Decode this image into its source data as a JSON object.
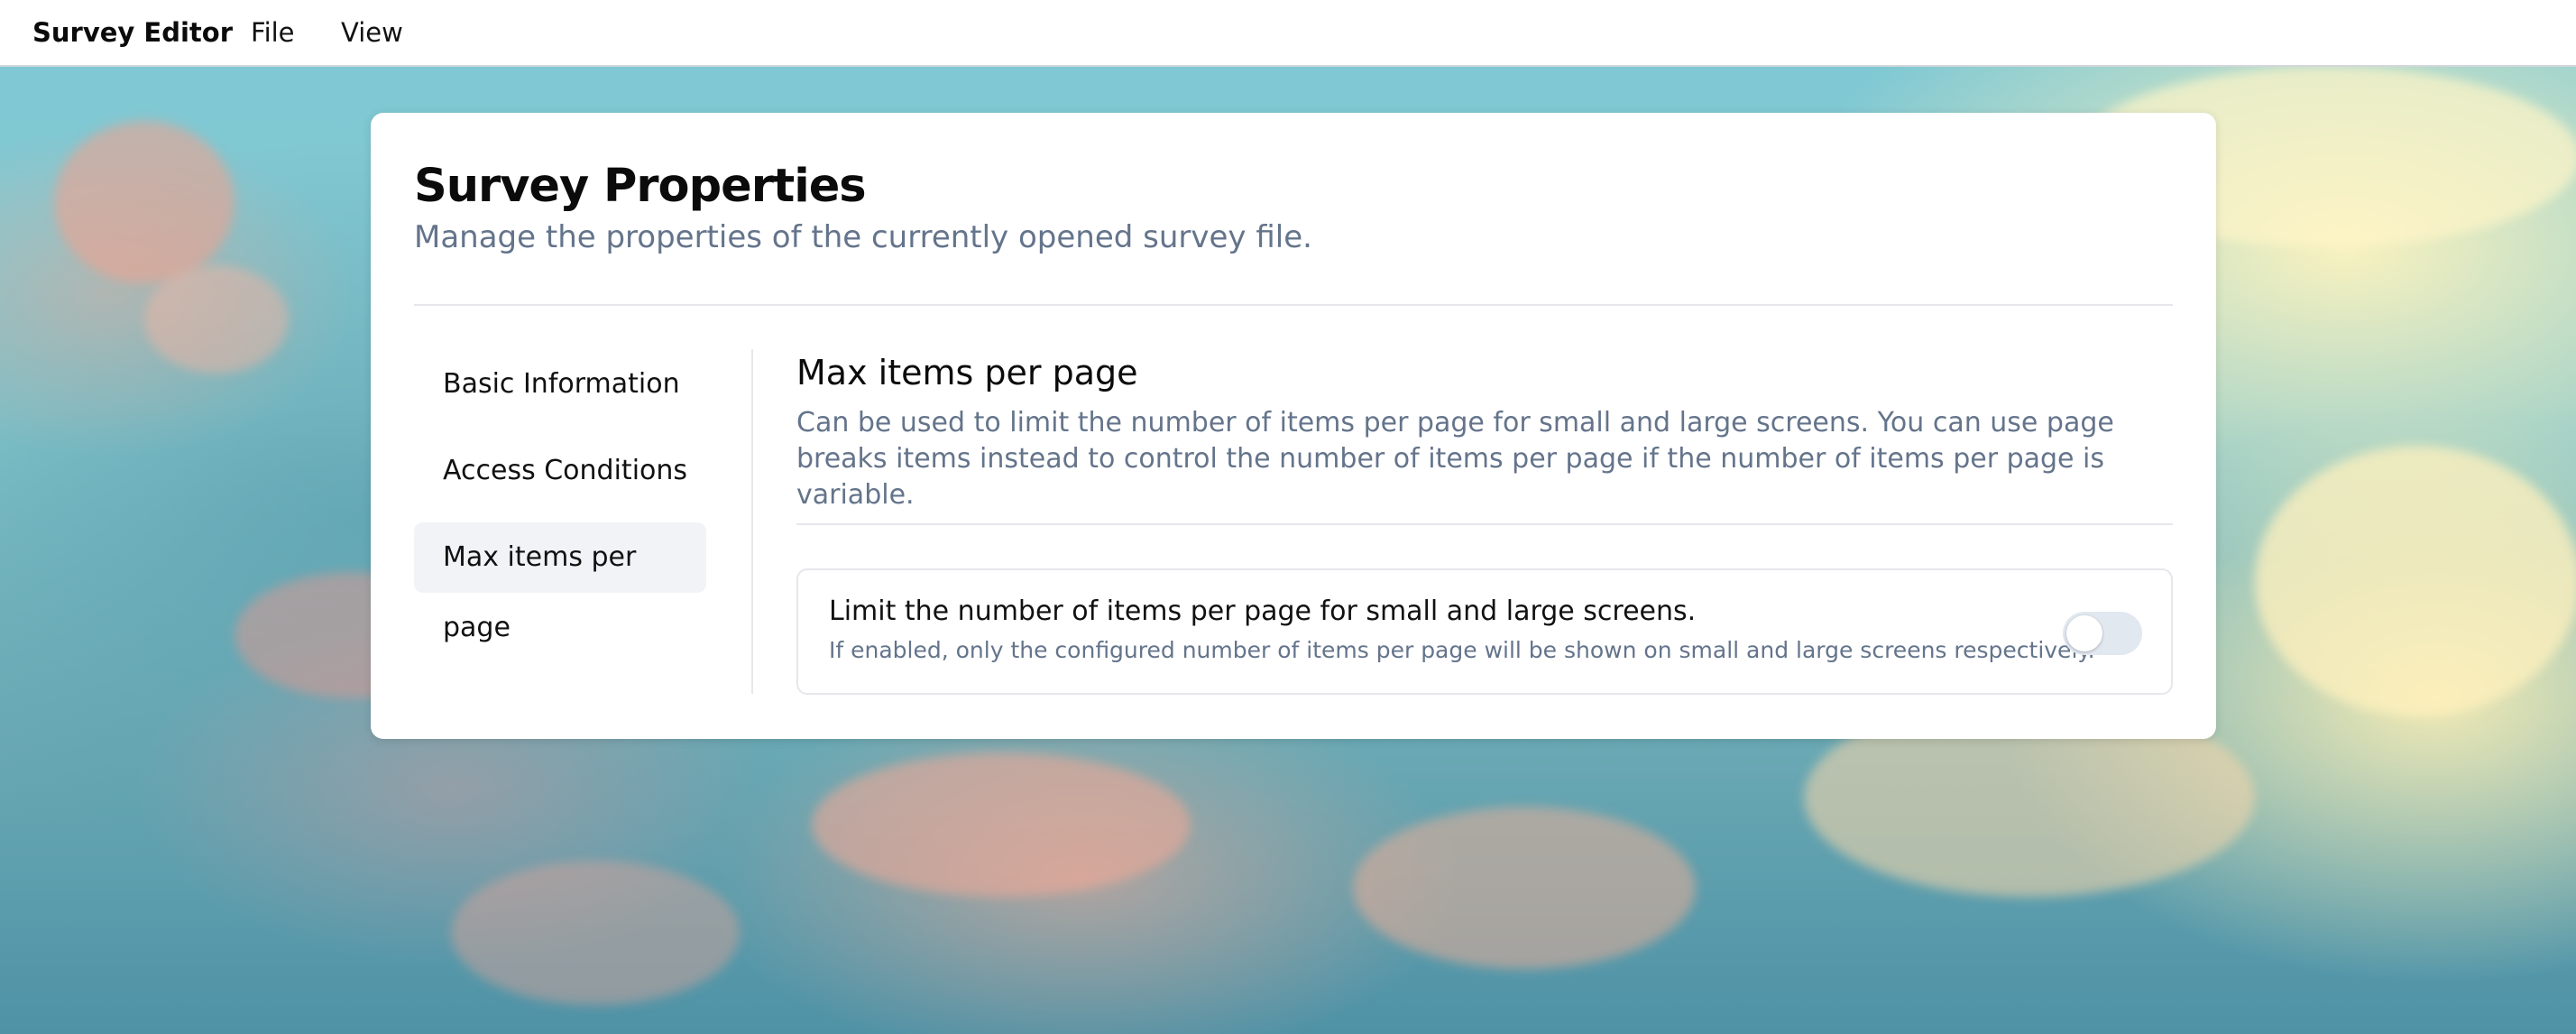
{
  "menubar": {
    "app_title": "Survey Editor",
    "items": [
      "File",
      "View"
    ]
  },
  "card": {
    "title": "Survey Properties",
    "subtitle": "Manage the properties of the currently opened survey file."
  },
  "nav": {
    "items": [
      {
        "label": "Basic Information",
        "active": false
      },
      {
        "label": "Access Conditions",
        "active": false
      },
      {
        "label": "Max items per page",
        "active": true
      }
    ]
  },
  "section": {
    "title": "Max items per page",
    "description": "Can be used to limit the number of items per page for small and large screens. You can use page breaks items instead to control the number of items per page if the number of items per page is variable."
  },
  "option": {
    "title": "Limit the number of items per page for small and large screens.",
    "description": "If enabled, only the configured number of items per page will be shown on small and large screens respectively.",
    "enabled": false
  },
  "colors": {
    "text_primary": "#0b0b0b",
    "text_muted": "#64748b",
    "active_bg": "#f1f3f6",
    "toggle_off": "#e2e8f0"
  }
}
